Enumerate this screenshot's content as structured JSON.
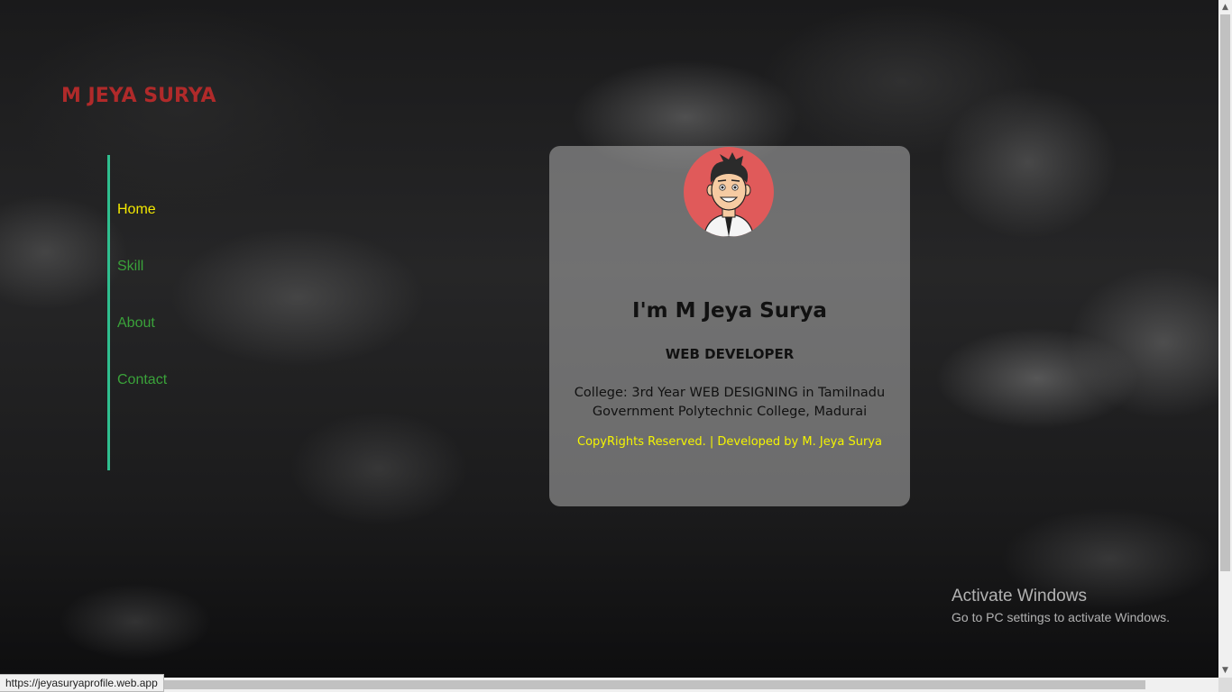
{
  "brand": {
    "name": "M JEYA SURYA",
    "color": "#b02a2a"
  },
  "nav": {
    "accent": "#2fbf8f",
    "items": [
      {
        "label": "Home",
        "active": true
      },
      {
        "label": "Skill",
        "active": false
      },
      {
        "label": "About",
        "active": false
      },
      {
        "label": "Contact",
        "active": false
      }
    ]
  },
  "profile": {
    "avatar": "cartoon-man-avatar",
    "title": "I'm M Jeya Surya",
    "role": "WEB DEVELOPER",
    "college": "College: 3rd Year WEB DESIGNING in Tamilnadu Government Polytechnic College, Madurai",
    "footer": "CopyRights Reserved. | Developed by M. Jeya Surya"
  },
  "os_overlay": {
    "title": "Activate Windows",
    "subtitle": "Go to PC settings to activate Windows."
  },
  "status_bar": {
    "url": "https://jeyasuryaprofile.web.app"
  }
}
